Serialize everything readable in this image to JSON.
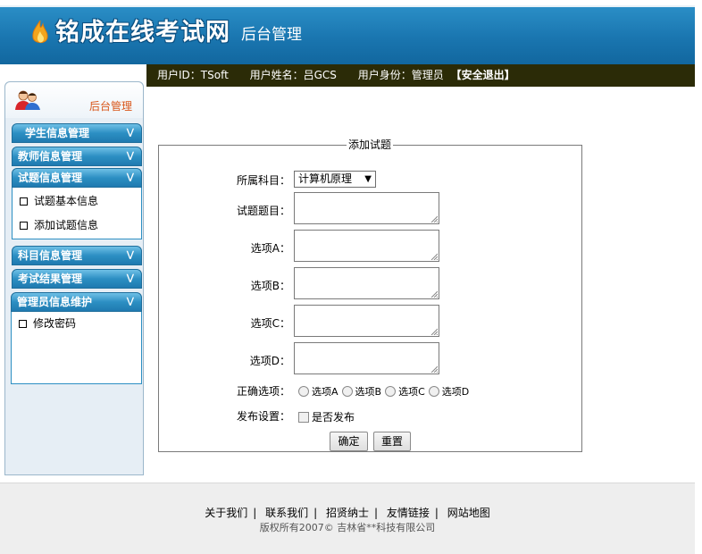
{
  "header": {
    "site_name": "铭成在线考试网",
    "subtitle": "后台管理"
  },
  "userbar": {
    "user_id": "用户ID：TSoft",
    "user_name": "用户姓名：吕GCS",
    "user_role": "用户身份：管理员",
    "logout": "【安全退出】"
  },
  "sidebar": {
    "title": "后台管理",
    "menus": [
      {
        "label": "学生信息管理",
        "items": []
      },
      {
        "label": "教师信息管理",
        "items": []
      },
      {
        "label": "试题信息管理",
        "items": [
          "试题基本信息",
          "添加试题信息"
        ]
      },
      {
        "label": "科目信息管理",
        "items": []
      },
      {
        "label": "考试结果管理",
        "items": []
      },
      {
        "label": "管理员信息维护",
        "items": [
          "修改密码"
        ]
      }
    ]
  },
  "form": {
    "legend": "添加试题",
    "subject_label": "所属科目：",
    "subject_value": "计算机原理",
    "title_label": "试题题目：",
    "option_a_label": "选项A：",
    "option_b_label": "选项B：",
    "option_c_label": "选项C：",
    "option_d_label": "选项D：",
    "correct_label": "正确选项：",
    "radio_options": [
      "选项A",
      "选项B",
      "选项C",
      "选项D"
    ],
    "publish_label": "发布设置：",
    "publish_checkbox": "是否发布",
    "submit": "确定",
    "reset": "重置"
  },
  "footer": {
    "links": [
      "关于我们",
      "联系我们",
      "招贤纳士",
      "友情链接",
      "网站地图"
    ],
    "copyright": "版权所有2007©  吉林省**科技有限公司"
  },
  "colors": {
    "header_blue": "#1a76b0",
    "userbar_bg": "#2b2b07",
    "sidebar_title": "#d9561a",
    "menu_blue": "#2c8fc3"
  }
}
